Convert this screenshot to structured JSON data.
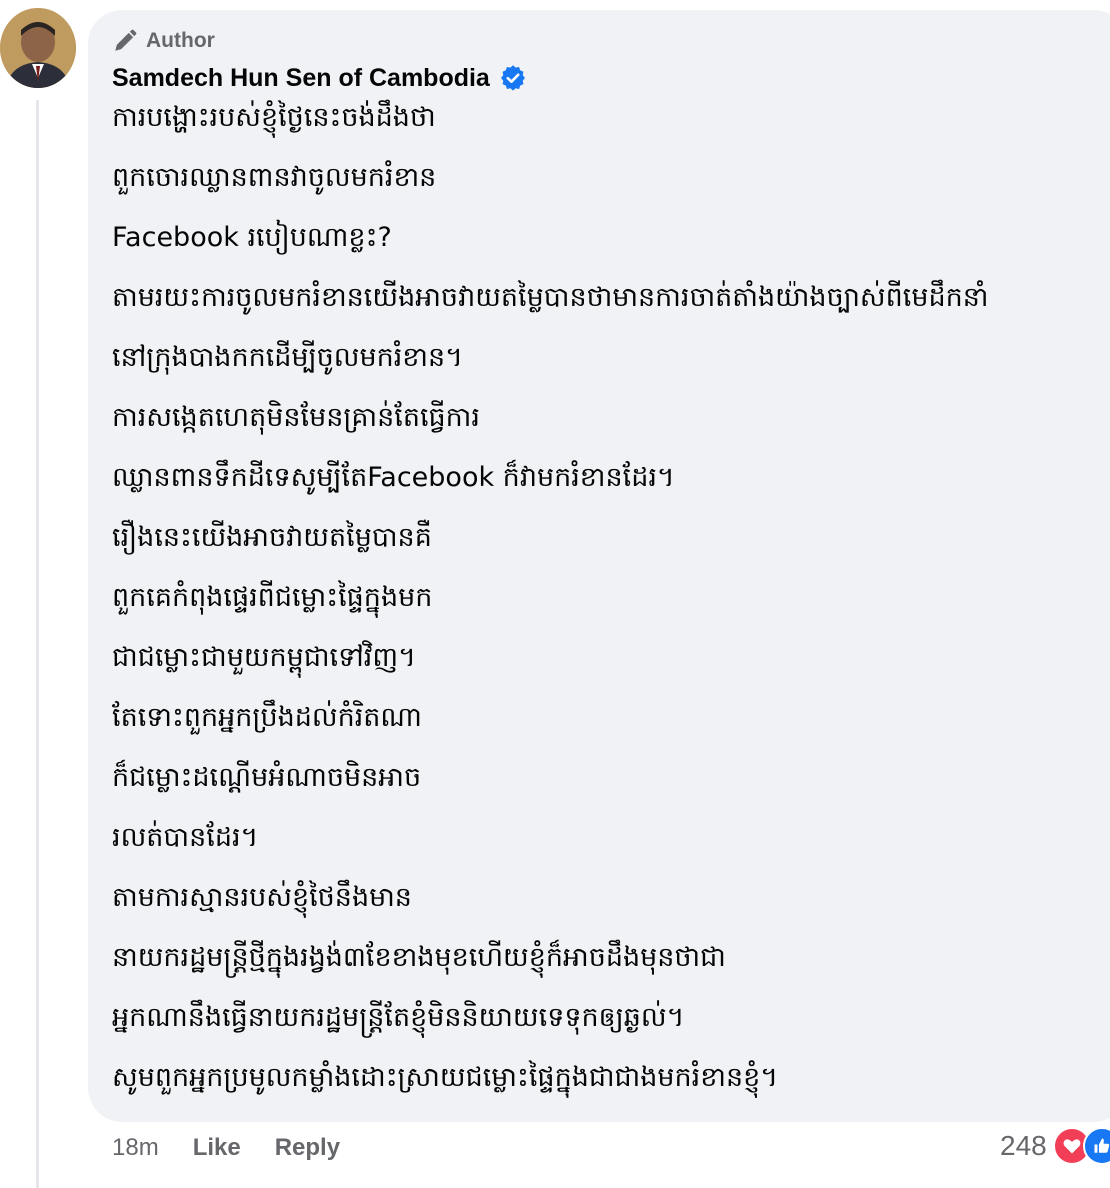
{
  "comment": {
    "badge": {
      "label": "Author",
      "icon": "pen-icon"
    },
    "author_name": "Samdech Hun Sen of Cambodia",
    "verified_icon": "verified-badge-icon",
    "lines": [
      "ការបង្ហោះរបស់ខ្ញុំថ្ងៃនេះចង់ដឹងថា",
      "ពួកចោរឈ្លានពានវាចូលមករំខាន",
      "Facebook របៀបណាខ្លះ?",
      "តាមរយះការចូលមករំខានយើងអាចវាយតម្លៃបានថាមានការចាត់តាំងយ៉ាងច្បាស់ពីមេដឹកនាំ",
      "នៅក្រុងបាងកកដើម្បីចូលមករំខាន។",
      "ការសង្កេតហេតុមិនមែនគ្រាន់តែធ្វើការ",
      "ឈ្លានពានទឹកដីទេសូម្បីតែFacebook ក៏វាមករំខានដែរ។",
      "រឿងនេះយើងអាចវាយតម្លៃបានគឺ",
      "ពួកគេកំពុងផ្ទេរពីជម្លោះផ្ទៃក្នុងមក",
      "ជាជម្លោះជាមួយកម្ពុជាទៅវិញ។",
      "តែទោះពួកអ្នកប្រឹងដល់កំរិតណា",
      "ក៏ជម្លោះដណ្តើមអំណាចមិនអាច",
      "រលត់បានដែរ។",
      "តាមការស្មានរបស់ខ្ញុំថៃនឹងមាន",
      "នាយករដ្ឋមន្ត្រីថ្មីក្នុងរង្វង់៣ខែខាងមុខហើយខ្ញុំក៏អាចដឹងមុនថាជា",
      "អ្នកណានឹងធ្វើនាយករដ្ឋមន្ត្រីតែខ្ញុំមិននិយាយទេទុកឲ្យឆ្ងល់។",
      "សូមពួកអ្នកប្រមូលកម្លាំងដោះស្រាយជម្លោះផ្ទៃក្នុងជាជាងមករំខានខ្ញុំ។"
    ],
    "footer": {
      "time": "18m",
      "like_label": "Like",
      "reply_label": "Reply"
    },
    "reactions": {
      "count": "248",
      "icons": [
        "love-reaction-icon",
        "like-reaction-icon"
      ],
      "love_color": "#f33e58",
      "like_color": "#1877f2"
    }
  },
  "colors": {
    "bubble": "#f0f2f5",
    "verified": "#1877f2",
    "text": "#050505",
    "secondary": "#65676b"
  }
}
